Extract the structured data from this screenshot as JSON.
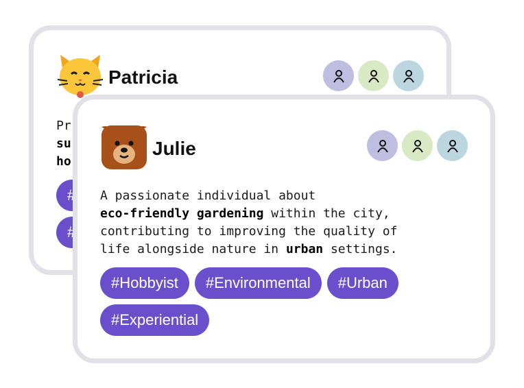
{
  "colors": {
    "tag_bg": "#6a4fcd",
    "card_border": "#e2e1e7",
    "follower_1": "#bfbde0",
    "follower_2": "#d8e9c4",
    "follower_3": "#bcd6e0"
  },
  "back_card": {
    "name": "Patricia",
    "avatar_icon": "cat-face-icon",
    "bio_start": "Pr",
    "bio_line2_bold": "su",
    "bio_line3_bold": "ho",
    "tags": [
      "#",
      "#"
    ]
  },
  "front_card": {
    "name": "Julie",
    "avatar_icon": "bear-face-icon",
    "bio": {
      "line1": "A passionate individual about",
      "line2_bold": "eco-friendly gardening",
      "line2_rest": " within the city,",
      "line3": "contributing to improving the quality of",
      "line4_start": "life alongside nature in ",
      "line4_bold": "urban",
      "line4_end": " settings."
    },
    "tags": [
      "#Hobbyist",
      "#Environmental",
      "#Urban",
      "#Experiential"
    ]
  },
  "followers_icon": "person-icon"
}
